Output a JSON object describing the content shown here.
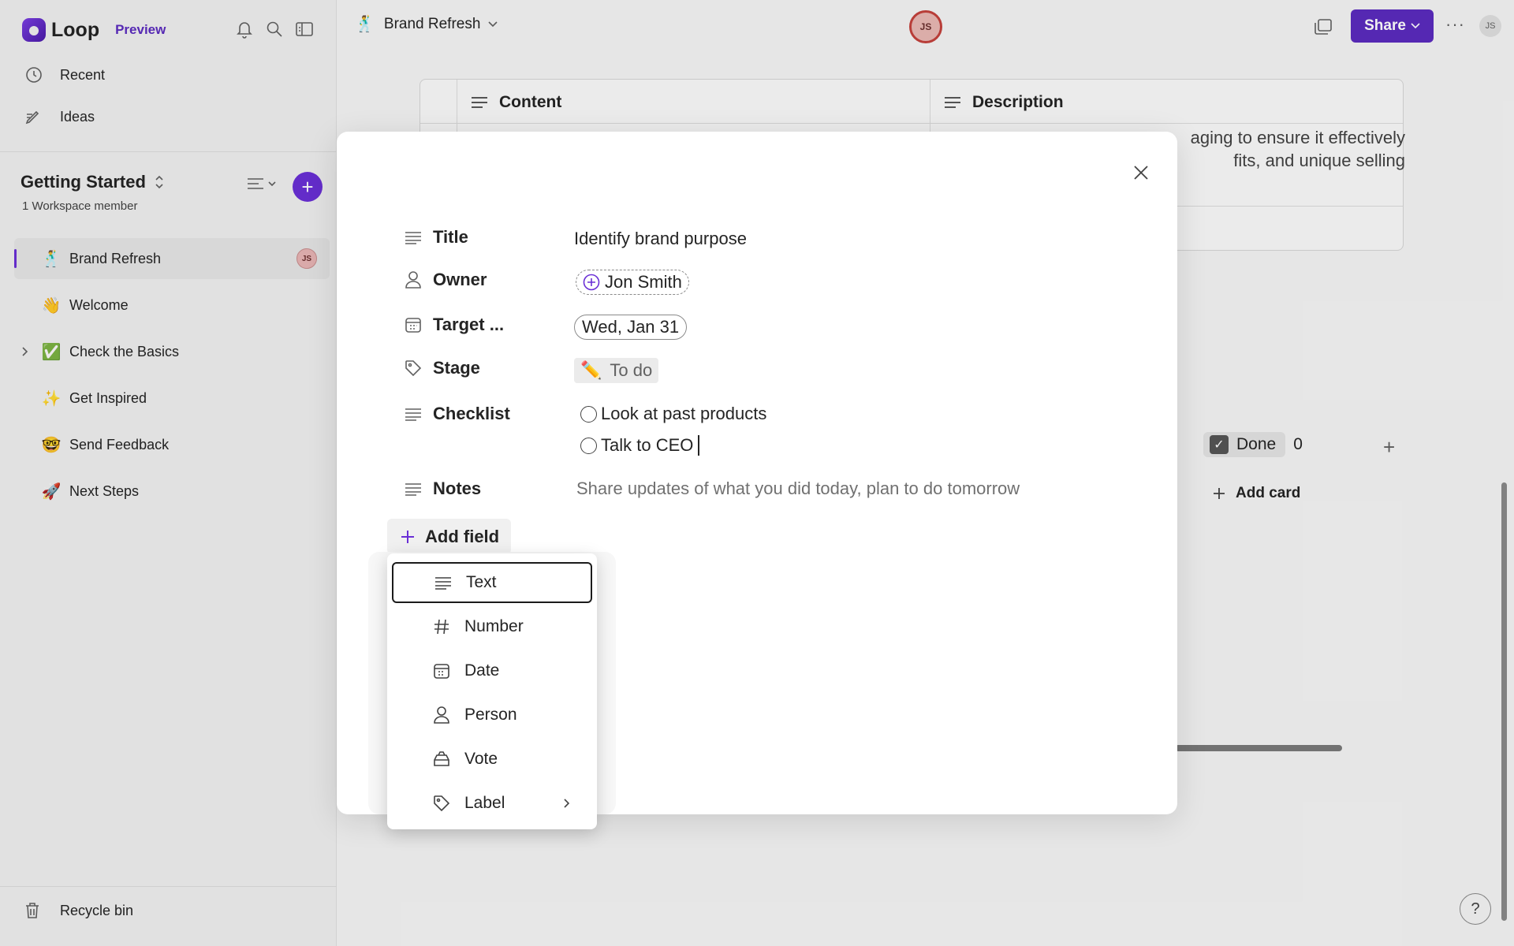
{
  "app": {
    "name": "Loop",
    "preview_label": "Preview"
  },
  "sidebar": {
    "nav": [
      {
        "label": "Recent",
        "icon": "clock-icon"
      },
      {
        "label": "Ideas",
        "icon": "pen-icon"
      }
    ],
    "workspace": {
      "title": "Getting Started",
      "members": "1 Workspace member"
    },
    "pages": [
      {
        "label": "Brand Refresh",
        "emoji": "🕺",
        "avatar": "JS",
        "active": true
      },
      {
        "label": "Welcome",
        "emoji": "👋"
      },
      {
        "label": "Check the Basics",
        "emoji": "✅"
      },
      {
        "label": "Get Inspired",
        "emoji": "✨"
      },
      {
        "label": "Send Feedback",
        "emoji": "🤓"
      },
      {
        "label": "Next Steps",
        "emoji": "🚀"
      }
    ],
    "recycle_bin": "Recycle bin"
  },
  "topbar": {
    "page_title": "Brand Refresh",
    "page_emoji": "🕺",
    "collaborator_initials": "JS",
    "share_label": "Share",
    "user_initials": "JS"
  },
  "canvas": {
    "table_columns": [
      "Content",
      "Description"
    ],
    "description_snippet_1": "aging to ensure it effectively",
    "description_snippet_2": "fits, and unique selling",
    "board_column": {
      "name": "Done",
      "count": "0"
    },
    "add_card": "Add card"
  },
  "modal": {
    "fields": {
      "title_label": "Title",
      "title_value": "Identify brand purpose",
      "owner_label": "Owner",
      "owner_value": "Jon Smith",
      "target_label": "Target ...",
      "target_value": "Wed, Jan 31",
      "stage_label": "Stage",
      "stage_value": "To do",
      "stage_emoji": "✏️",
      "checklist_label": "Checklist",
      "checklist_items": [
        "Look at past products",
        "Talk to CEO"
      ],
      "notes_label": "Notes",
      "notes_placeholder": "Share updates of what you did today, plan to do tomorrow"
    },
    "add_field_label": "Add field",
    "field_types": [
      "Text",
      "Number",
      "Date",
      "Person",
      "Vote",
      "Label"
    ]
  },
  "help": "?",
  "colors": {
    "accent": "#5b2bbf",
    "accent_bright": "#6a2fd6",
    "avatar_ring": "#c4413c"
  }
}
